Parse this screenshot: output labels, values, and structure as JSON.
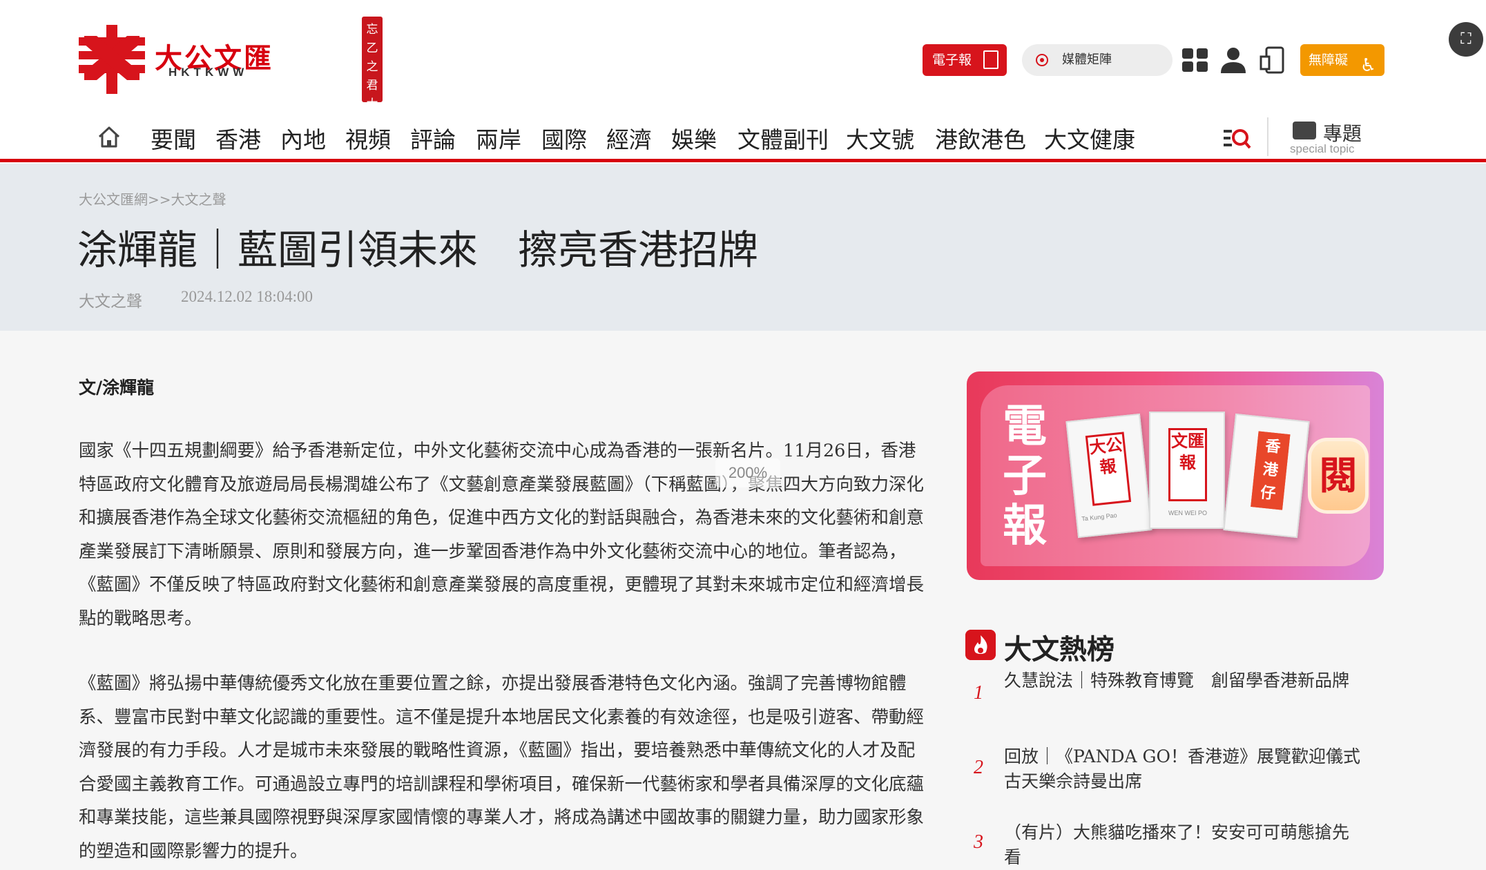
{
  "header": {
    "logo_title": "大公文匯",
    "logo_subtitle": "HKTKWW",
    "seal_text": "忘乙之君大",
    "epaper_label": "電子報",
    "media_matrix_label": "媒體矩陣",
    "accessibility_label": "無障礙"
  },
  "nav": {
    "items": [
      "要聞",
      "香港",
      "內地",
      "視頻",
      "評論",
      "兩岸",
      "國際",
      "經濟",
      "娛樂",
      "文體副刊",
      "大文號",
      "港飲港色",
      "大文健康"
    ],
    "topic_label": "專題",
    "topic_sublabel": "special topic"
  },
  "article": {
    "breadcrumb": "大公文匯網>>大文之聲",
    "title": "涂輝龍｜藍圖引領未來　擦亮香港招牌",
    "source": "大文之聲",
    "datetime": "2024.12.02 18:04:00",
    "author": "文/涂輝龍",
    "paragraphs": [
      "國家《十四五規劃綱要》給予香港新定位，中外文化藝術交流中心成為香港的一張新名片。11月26日，香港特區政府文化體育及旅遊局局長楊潤雄公布了《文藝創意產業發展藍圖》（下稱藍圖），聚焦四大方向致力深化和擴展香港作為全球文化藝術交流樞紐的角色，促進中西方文化的對話與融合，為香港未來的文化藝術和創意產業發展訂下清晰願景、原則和發展方向，進一步鞏固香港作為中外文化藝術交流中心的地位。筆者認為，《藍圖》不僅反映了特區政府對文化藝術和創意產業發展的高度重視，更體現了其對未來城市定位和經濟增長點的戰略思考。",
      "《藍圖》將弘揚中華傳統優秀文化放在重要位置之餘，亦提出發展香港特色文化內涵。強調了完善博物館體系、豐富市民對中華文化認識的重要性。這不僅是提升本地居民文化素養的有效途徑，也是吸引遊客、帶動經濟發展的有力手段。人才是城市未來發展的戰略性資源，《藍圖》指出，要培養熟悉中華傳統文化的人才及配合愛國主義教育工作。可通過設立專門的培訓課程和學術項目，確保新一代藝術家和學者具備深厚的文化底蘊和專業技能，這些兼具國際視野與深厚家國情懷的專業人才，將成為講述中國故事的關鍵力量，助力國家形象的塑造和國際影響力的提升。"
    ]
  },
  "zoom_indicator": "200%",
  "sidebar": {
    "banner": {
      "title": "電子報",
      "papers": [
        "大公報",
        "文匯報",
        "香港仔"
      ],
      "paper_footers": [
        "Ta Kung Pao",
        "WEN WEI PO"
      ],
      "read_label": "閱"
    },
    "hot_list": {
      "title": "大文熱榜",
      "items": [
        {
          "rank": "1",
          "text": "久慧說法｜特殊教育博覽　創留學香港新品牌"
        },
        {
          "rank": "2",
          "text": "回放｜《PANDA GO！香港遊》展覽歡迎儀式　古天樂佘詩曼出席"
        },
        {
          "rank": "3",
          "text": "（有片）大熊貓吃播來了！安安可可萌態搶先看"
        }
      ]
    }
  },
  "colors": {
    "brand_red": "#d7000f",
    "accessibility_orange": "#f39800",
    "title_band": "#e6eaee"
  }
}
